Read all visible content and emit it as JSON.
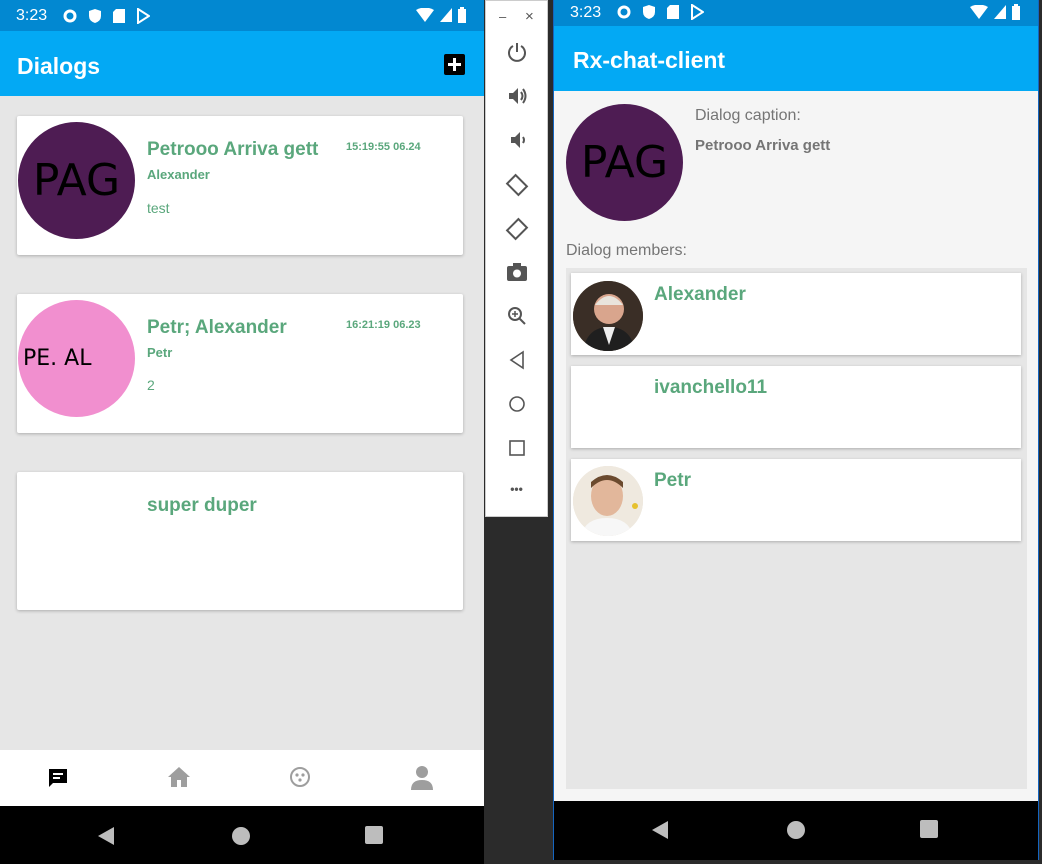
{
  "left_phone": {
    "status_time": "3:23",
    "title": "Dialogs",
    "dialogs": [
      {
        "avatar_text": "PAG",
        "avatar_color": "#4e1c53",
        "title": "Petrooo Arriva gett",
        "time": "15:19:55 06.24",
        "sender": "Alexander",
        "last_message": "test"
      },
      {
        "avatar_text": "PE. AL",
        "avatar_color": "#f18fcf",
        "title": "Petr; Alexander",
        "time": "16:21:19 06.23",
        "sender": "Petr",
        "last_message": "2"
      },
      {
        "avatar_text": "",
        "avatar_color": "#ffffff",
        "title": "super duper",
        "time": "",
        "sender": "",
        "last_message": ""
      }
    ],
    "tabs": [
      "chat-icon",
      "home-icon",
      "explore-icon",
      "person-icon"
    ]
  },
  "emulator_toolbar": {
    "minimize": "–",
    "close": "×",
    "buttons": [
      "power-icon",
      "volume-up-icon",
      "volume-down-icon",
      "rotate-left-icon",
      "rotate-right-icon",
      "camera-icon",
      "zoom-icon",
      "back-icon",
      "home-icon",
      "overview-icon",
      "more-icon"
    ],
    "more_label": "•••"
  },
  "right_phone": {
    "status_time": "3:23",
    "title": "Rx-chat-client",
    "avatar_text": "PAG",
    "avatar_color": "#4e1c53",
    "caption_label": "Dialog caption:",
    "caption_value": "Petrooo Arriva gett",
    "members_label": "Dialog members:",
    "members": [
      {
        "name": "Alexander",
        "has_photo": true
      },
      {
        "name": "ivanchello11",
        "has_photo": false
      },
      {
        "name": "Petr",
        "has_photo": true
      }
    ]
  },
  "colors": {
    "primary": "#03a9f4",
    "status": "#0288d1",
    "accent_text": "#5aa77c"
  }
}
